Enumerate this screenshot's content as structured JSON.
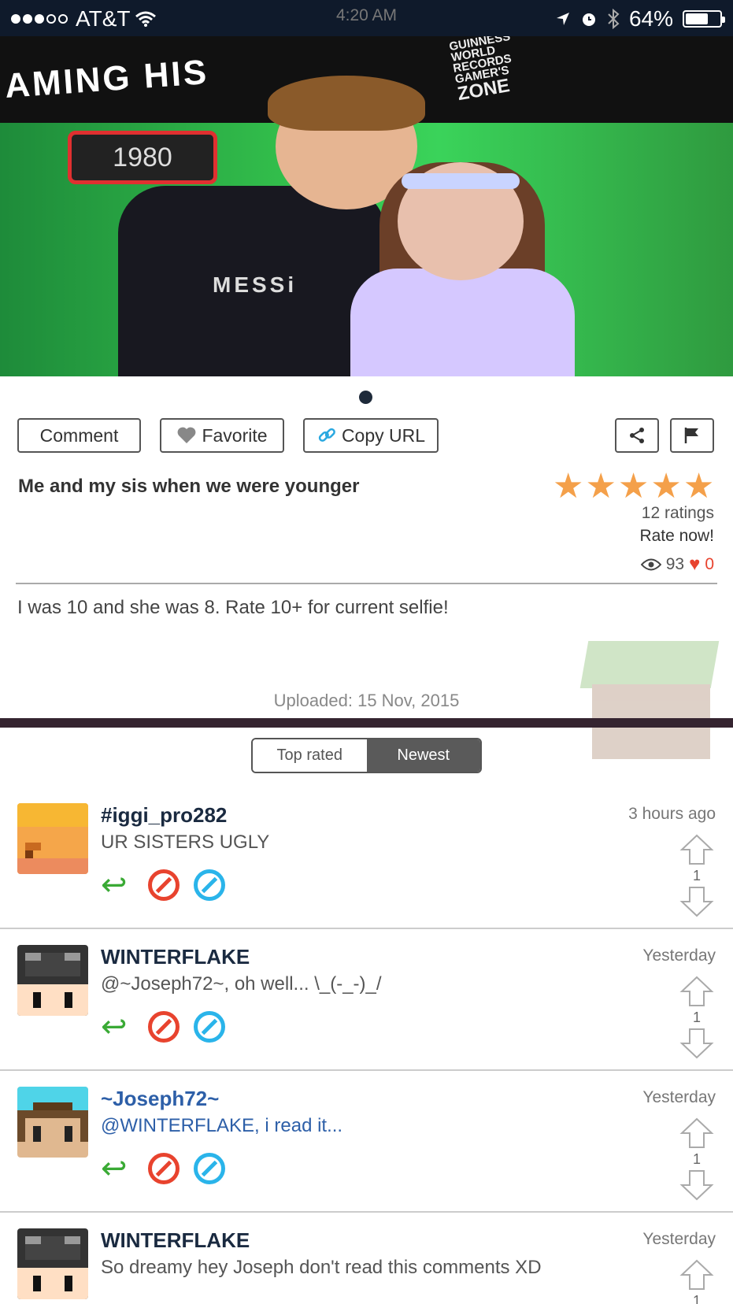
{
  "status_bar": {
    "carrier": "AT&T",
    "time": "4:20 AM",
    "battery": "64%"
  },
  "photo": {
    "banner": "AMING HIS",
    "gwr_lines": [
      "GUINNESS",
      "WORLD",
      "RECORDS",
      "GAMER'S"
    ],
    "gwr_zone": "ZONE",
    "year": "1980",
    "shirt": "MESSi"
  },
  "actions": {
    "comment": "Comment",
    "favorite": "Favorite",
    "copy_url": "Copy URL"
  },
  "post": {
    "title": "Me and my sis when we were younger",
    "rating_value": 5,
    "ratings": "12 ratings",
    "rate_now": "Rate now!",
    "views": "93",
    "likes": "0",
    "description": "I was 10 and she was 8. Rate 10+ for current selfie!",
    "uploaded": "Uploaded: 15 Nov, 2015"
  },
  "sort": {
    "top_rated": "Top rated",
    "newest": "Newest",
    "selected": "Newest"
  },
  "comments": [
    {
      "user": "#iggi_pro282",
      "text": "UR SISTERS UGLY",
      "time": "3 hours ago",
      "votes": "1"
    },
    {
      "user": "WINTERFLAKE",
      "text": "@~Joseph72~, oh well... \\_(-_-)_/",
      "time": "Yesterday",
      "votes": "1"
    },
    {
      "user": "~Joseph72~",
      "text": "@WINTERFLAKE, i read it...",
      "time": "Yesterday",
      "votes": "1"
    },
    {
      "user": "WINTERFLAKE",
      "text": "So dreamy hey Joseph don't read this comments XD",
      "time": "Yesterday",
      "votes": "1"
    }
  ],
  "colors": {
    "star": "#f4a04a",
    "reply": "#3aaa35",
    "block": "#e8432e",
    "ban": "#2ab4ea"
  }
}
